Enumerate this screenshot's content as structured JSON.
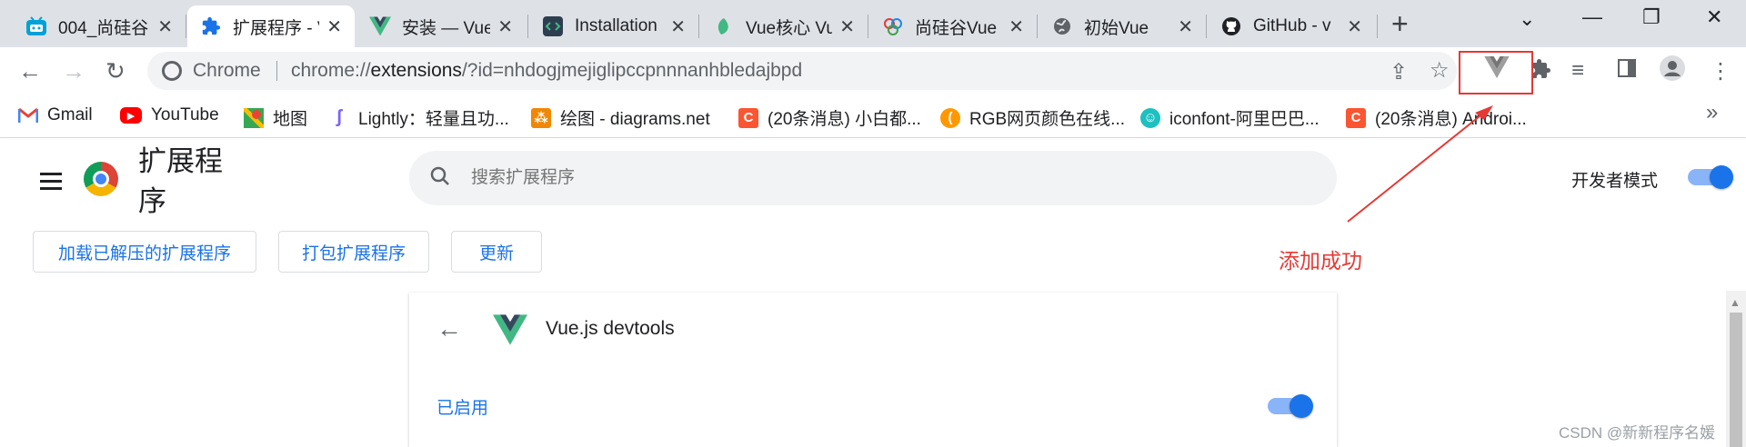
{
  "tabs": [
    {
      "title": "004_尚硅谷",
      "icon": "bilibili-icon",
      "active": false
    },
    {
      "title": "扩展程序 - V",
      "icon": "puzzle-icon",
      "active": true
    },
    {
      "title": "安装 — Vue",
      "icon": "vue-icon",
      "active": false
    },
    {
      "title": "Installation",
      "icon": "code-icon",
      "active": false
    },
    {
      "title": "Vue核心 Vue",
      "icon": "leaf-icon",
      "active": false
    },
    {
      "title": "尚硅谷Vue",
      "icon": "baidu-icon",
      "active": false
    },
    {
      "title": "初始Vue",
      "icon": "globe-icon",
      "active": false
    },
    {
      "title": "GitHub - v",
      "icon": "github-icon",
      "active": false
    }
  ],
  "toolbar": {
    "site_label": "Chrome",
    "url_host": "extensions",
    "url_prefix": "chrome://",
    "url_rest": "/?id=nhdogjmejiglipccpnnnanhbledajbpd"
  },
  "bookmarks": [
    {
      "label": "Gmail",
      "icon": "gmail-icon",
      "color": "#ea4335"
    },
    {
      "label": "YouTube",
      "icon": "youtube-icon",
      "color": "#ff0000"
    },
    {
      "label": "地图",
      "icon": "maps-icon",
      "color": "#34a853"
    },
    {
      "label": "Lightly：轻量且功...",
      "icon": "lightly-icon",
      "color": "#7b61ff"
    },
    {
      "label": "绘图 - diagrams.net",
      "icon": "diagrams-icon",
      "color": "#f08705"
    },
    {
      "label": "(20条消息) 小白都...",
      "icon": "csdn-icon",
      "color": "#fc5531"
    },
    {
      "label": "RGB网页颜色在线...",
      "icon": "rgb-icon",
      "color": "#ff9800"
    },
    {
      "label": "iconfont-阿里巴巴...",
      "icon": "iconfont-icon",
      "color": "#1ec0c0"
    },
    {
      "label": "(20条消息) Androi...",
      "icon": "csdn-icon",
      "color": "#fc5531"
    }
  ],
  "extensions_page": {
    "title": "扩展程序",
    "search_placeholder": "搜索扩展程序",
    "dev_mode_label": "开发者模式",
    "dev_mode_on": true,
    "buttons": {
      "load_unpacked": "加载已解压的扩展程序",
      "pack": "打包扩展程序",
      "update": "更新"
    }
  },
  "detail": {
    "name": "Vue.js devtools",
    "enabled_label": "已启用",
    "enabled": true
  },
  "annotation": {
    "text": "添加成功",
    "color": "#e53935"
  },
  "watermark": "CSDN @新新程序名媛"
}
